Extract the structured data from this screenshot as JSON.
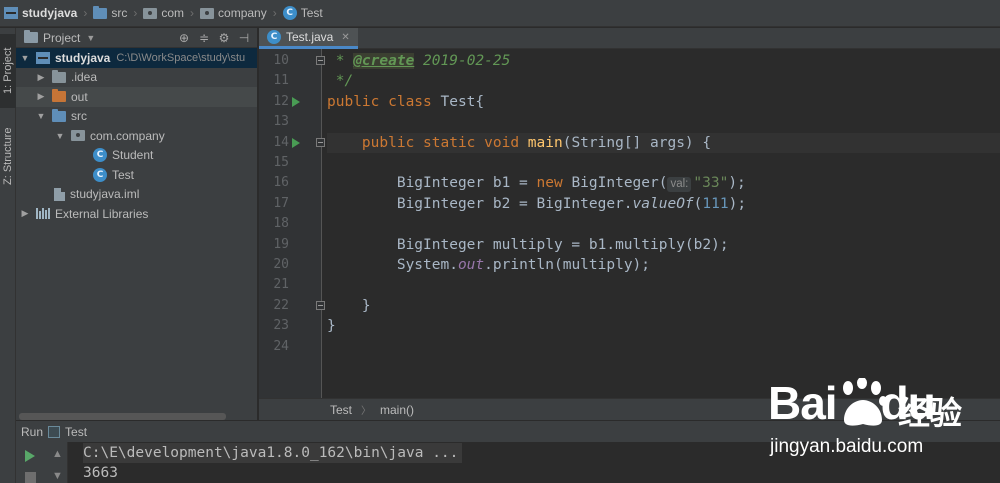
{
  "navbar": {
    "items": [
      {
        "label": "studyjava",
        "icon": "module-icon"
      },
      {
        "label": "src",
        "icon": "folder-icon"
      },
      {
        "label": "com",
        "icon": "package-icon"
      },
      {
        "label": "company",
        "icon": "package-icon"
      },
      {
        "label": "Test",
        "icon": "class-icon"
      }
    ]
  },
  "leftstrip": {
    "project_tab": "1: Project",
    "structure_tab": "Z: Structure"
  },
  "project": {
    "header_label": "Project",
    "header_buttons": [
      "target-icon",
      "collapse-icon",
      "gear-icon",
      "hide-icon"
    ],
    "tree": [
      {
        "label": "studyjava",
        "path": "C:\\D\\WorkSpace\\study\\stu",
        "depth": 0,
        "arrow": "expanded",
        "icon": "module",
        "bold": true,
        "selected": true
      },
      {
        "label": ".idea",
        "depth": 1,
        "arrow": "collapsed",
        "icon": "folder-grey"
      },
      {
        "label": "out",
        "depth": 1,
        "arrow": "collapsed",
        "icon": "folder-orange",
        "highlighted": true
      },
      {
        "label": "src",
        "depth": 1,
        "arrow": "expanded",
        "icon": "folder-blue"
      },
      {
        "label": "com.company",
        "depth": 2,
        "arrow": "expanded",
        "icon": "package"
      },
      {
        "label": "Student",
        "depth": 3,
        "arrow": "none",
        "icon": "class"
      },
      {
        "label": "Test",
        "depth": 3,
        "arrow": "none",
        "icon": "class"
      },
      {
        "label": "studyjava.iml",
        "depth": 1,
        "arrow": "none",
        "icon": "file"
      },
      {
        "label": "External Libraries",
        "depth": 0,
        "arrow": "collapsed",
        "icon": "library"
      }
    ]
  },
  "editor": {
    "tab_label": "Test.java",
    "class_glyph": "C",
    "close_glyph": "✕",
    "lines": [
      {
        "n": "10"
      },
      {
        "n": "11"
      },
      {
        "n": "12"
      },
      {
        "n": "13"
      },
      {
        "n": "14"
      },
      {
        "n": "15"
      },
      {
        "n": "16"
      },
      {
        "n": "17"
      },
      {
        "n": "18"
      },
      {
        "n": "19"
      },
      {
        "n": "20"
      },
      {
        "n": "21"
      },
      {
        "n": "22"
      },
      {
        "n": "23"
      },
      {
        "n": "24"
      }
    ],
    "code": {
      "l10_star": " * ",
      "l10_tag": "@create",
      "l10_date": " 2019-02-25",
      "l11": " */",
      "l12_kw": "public class",
      "l12_rest": " Test{",
      "l14_indent": "    ",
      "l14_kw": "public static void",
      "l14_sp": " ",
      "l14_fn": "main",
      "l14_rest": "(String[] args) {",
      "l16_a": "        BigInteger b1 = ",
      "l16_kw": "new",
      "l16_b": " BigInteger(",
      "l16_hint": "val:",
      "l16_str": "\"33\"",
      "l16_c": ");",
      "l17_a": "        BigInteger b2 = BigInteger.",
      "l17_it": "valueOf",
      "l17_b": "(",
      "l17_num": "111",
      "l17_c": ");",
      "l19": "        BigInteger multiply = b1.multiply(b2);",
      "l20_a": "        System.",
      "l20_fld": "out",
      "l20_b": ".println(multiply);",
      "l22": "    }",
      "l23": "}"
    },
    "run_markers": [
      "12",
      "14"
    ]
  },
  "breadcrumb": {
    "class": "Test",
    "method": "main()",
    "sep": "〉"
  },
  "run": {
    "title_prefix": "Run",
    "config": "Test",
    "command": "C:\\E\\development\\java1.8.0_162\\bin\\java ...",
    "output": "3663"
  },
  "watermark": {
    "logo": "Bai",
    "logo_tail": "du",
    "cn": "经验",
    "url": "jingyan.baidu.com"
  }
}
